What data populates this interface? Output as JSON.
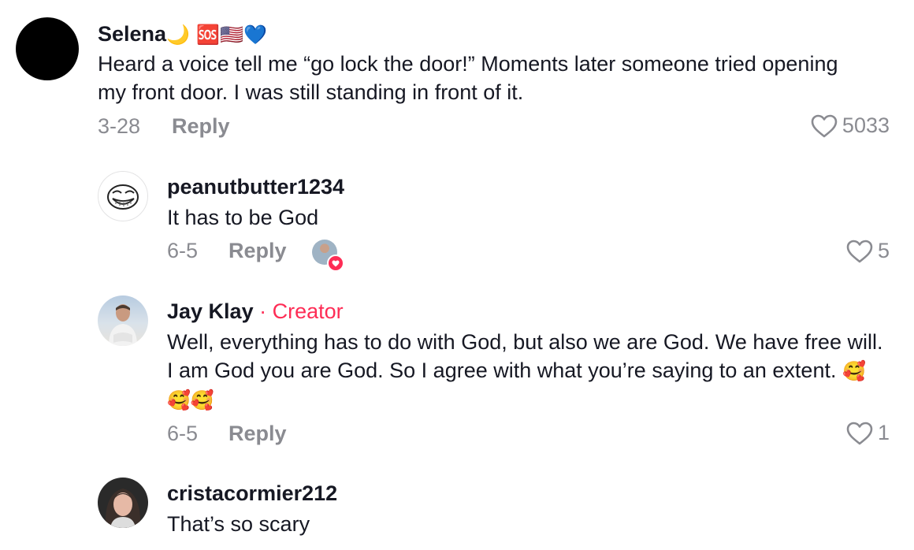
{
  "comments": [
    {
      "username": "Selena",
      "badges": "🌙 🆘🇺🇸💙",
      "text": "Heard a voice tell me “go lock the door!” Moments later someone tried opening my front door. I was still standing in front of it.",
      "date": "3-28",
      "reply_label": "Reply",
      "likes": "5033"
    },
    {
      "username": "peanutbutter1234",
      "text": "It has to be God",
      "date": "6-5",
      "reply_label": "Reply",
      "likes": "5"
    },
    {
      "username": "Jay Klay",
      "separator": "·",
      "creator_label": "Creator",
      "text": "Well, everything has to do with God, but also we are God. We have free will. I am God you are God. So I agree with what you’re saying to an extent.",
      "emojis": "🥰🥰🥰",
      "date": "6-5",
      "reply_label": "Reply",
      "likes": "1"
    },
    {
      "username": "cristacormier212",
      "text": "That’s so scary"
    }
  ],
  "colors": {
    "accent": "#fe2c55",
    "meta": "#8a8b91",
    "text": "#161823"
  }
}
